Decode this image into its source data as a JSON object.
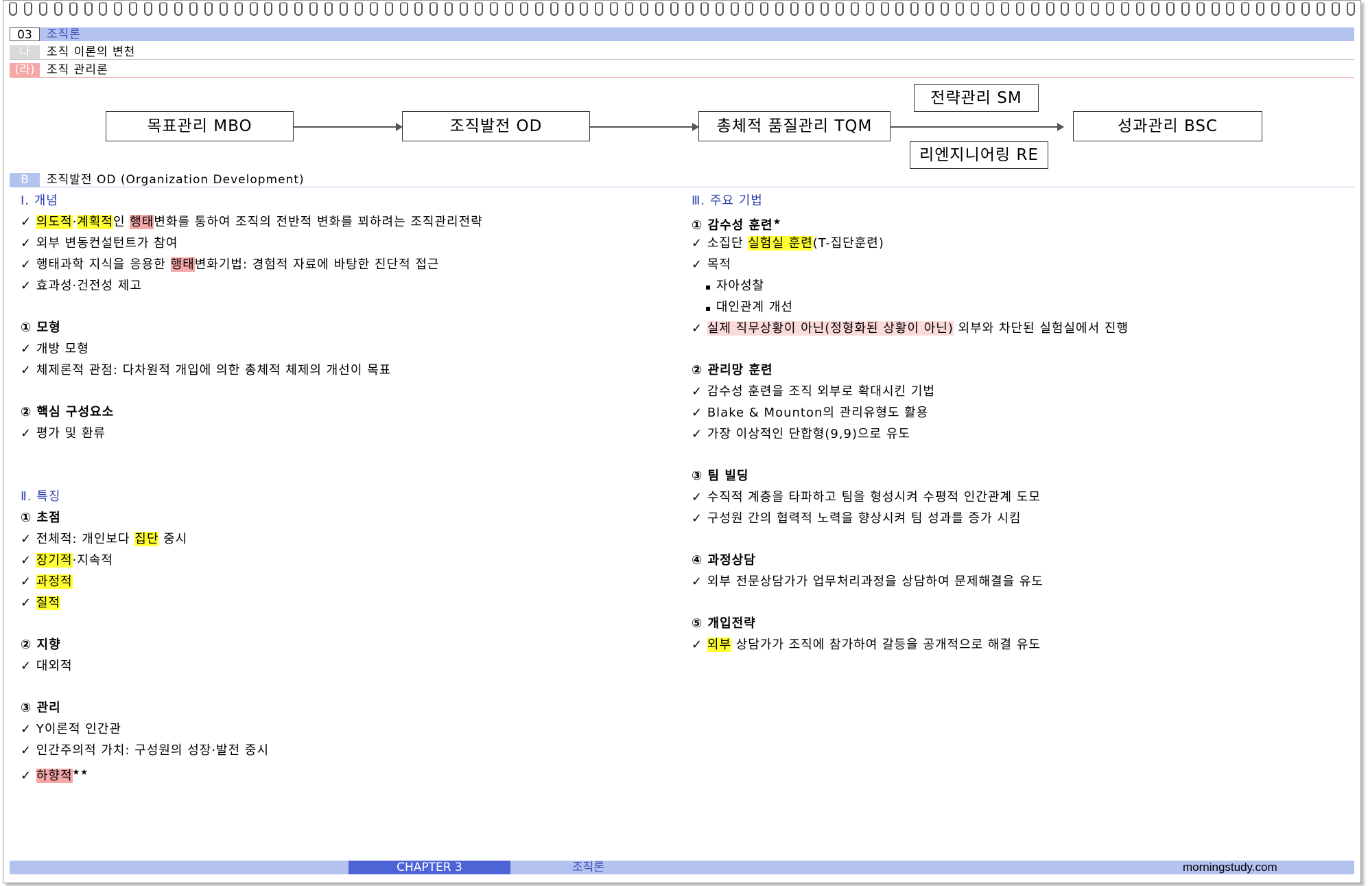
{
  "header": {
    "chapter_num": "03",
    "chapter_title": "조직론",
    "section_tag": "나",
    "section_title": "조직 이론의 변천",
    "subsection_tag": "(라)",
    "subsection_title": "조직 관리론",
    "b_tag": "B",
    "b_title": "조직발전 OD (Organization Development)"
  },
  "flow": {
    "mbo": "목표관리  MBO",
    "od": "조직발전 OD",
    "tqm": "총체적 품질관리 TQM",
    "sm": "전략관리 SM",
    "re": "리엔지니어링 RE",
    "bsc": "성과관리 BSC"
  },
  "left": {
    "concept_title": "Ⅰ. 개념",
    "c1_a": "의도적",
    "c1_b": "·",
    "c1_c": "계획적",
    "c1_d": "인 ",
    "c1_e": "행태",
    "c1_f": "변화를 통하여 조직의 전반적 변화를 꾀하려는 조직관리전략",
    "c2": "외부 변동컨설턴트가 참여",
    "c3_a": "행태과학 지식을 응용한 ",
    "c3_b": "행태",
    "c3_c": "변화기법: 경험적 자료에 바탕한 진단적 접근",
    "c4": "효과성·건전성 제고",
    "model_title": "① 모형",
    "m1": "개방 모형",
    "m2": "체제론적 관점: 다차원적 개입에 의한 총체적 체제의 개선이 목표",
    "core_title": "② 핵심 구성요소",
    "k1": "평가 및 환류",
    "feat_title": "Ⅱ. 특징",
    "focus_title": "① 초점",
    "f1_a": "전체적: 개인보다 ",
    "f1_b": "집단",
    "f1_c": " 중시",
    "f2_a": "장기적",
    "f2_b": "·지속적",
    "f3": "과정적",
    "f4": "질적",
    "orient_title": "② 지향",
    "o1": "대외적",
    "mgmt_title": "③ 관리",
    "g1": "Y이론적 인간관",
    "g2": "인간주의적 가치: 구성원의 성장·발전 중시",
    "g3": "하향적",
    "g3_star": "★★"
  },
  "right": {
    "tech_title": "Ⅲ. 주요 기법",
    "s_title": "① 감수성 훈련",
    "s_star": "★",
    "s1_a": "소집단 ",
    "s1_b": "실험실 훈련",
    "s1_c": "(T-집단훈련)",
    "s2": "목적",
    "s2a": "자아성찰",
    "s2b": "대인관계 개선",
    "s3_a": "실제 직무상황이 아닌(정형화된 상황이 아닌)",
    "s3_b": " 외부와 차단된 실험실에서 진행",
    "g_title": "② 관리망 훈련",
    "gr1": "감수성 훈련을 조직 외부로 확대시킨 기법",
    "gr2": "Blake & Mounton의 관리유형도 활용",
    "gr3": "가장 이상적인 단합형(9,9)으로 유도",
    "t_title": "③ 팀 빌딩",
    "t1": "수직적 계층을 타파하고 팀을 형성시켜 수평적 인간관계 도모",
    "t2": "구성원 간의 협력적 노력을 향상시켜 팀 성과를 증가 시킴",
    "p_title": "④ 과정상담",
    "p1": "외부 전문상담가가 업무처리과정을 상담하여 문제해결을 유도",
    "i_title": "⑤ 개입전략",
    "i1_a": "외부",
    "i1_b": " 상담가가 조직에 참가하여 갈등을 공개적으로 해결 유도"
  },
  "symbols": {
    "check": "✓",
    "bullet": "▪"
  },
  "footer": {
    "chapter": "CHAPTER 3",
    "name": "조직론",
    "site": "morningstudy.com"
  }
}
